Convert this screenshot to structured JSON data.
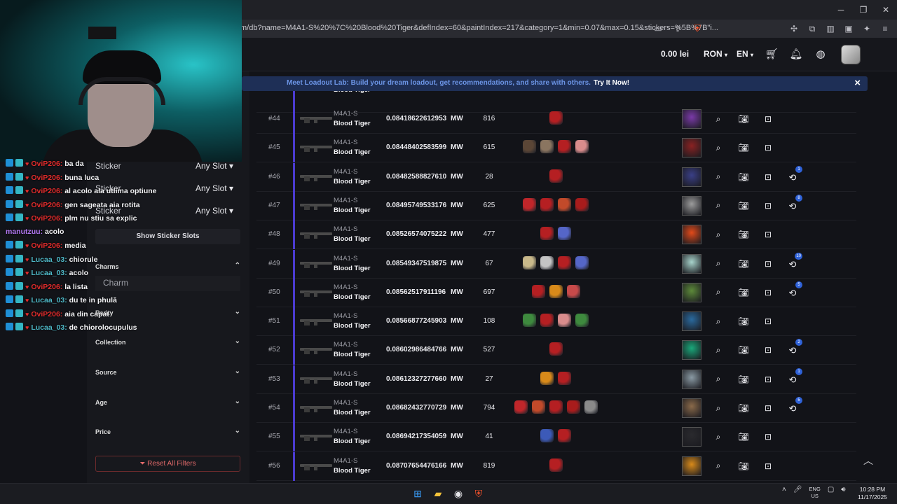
{
  "browser": {
    "url": "m/db?name=M4A1-S%20%7C%20Blood%20Tiger&defIndex=60&paintIndex=217&category=1&min=0.07&max=0.15&stickers=%5B%7B\"i..."
  },
  "header": {
    "balance": "0.00 lei",
    "currency": "RON",
    "language": "EN"
  },
  "banner": {
    "text": "Meet Loadout Lab: Build your dream loadout, get recommendations, and share with others.",
    "link": "Try It Now!",
    "close": "×"
  },
  "filters": {
    "sticker_rows": [
      {
        "label": "Sticker",
        "value": "Any Slot"
      },
      {
        "label": "Sticker",
        "value": "Any Slot"
      },
      {
        "label": "Sticker",
        "value": "Any Slot"
      }
    ],
    "show_sticker_slots": "Show Sticker Slots",
    "charms_head": "Charms",
    "charm_placeholder": "Charm",
    "rarity_head": "Rarity",
    "collection_head": "Collection",
    "source_head": "Source",
    "age_head": "Age",
    "price_head": "Price",
    "reset": "Reset All Filters"
  },
  "partial_row": {
    "skin": "Blood Tiger"
  },
  "rows": [
    {
      "idx": "#44",
      "weapon": "M4A1-S",
      "skin": "Blood Tiger",
      "float": "0.08418622612953",
      "wear": "MW",
      "seed": "816",
      "stickers": [
        "#b51f22"
      ],
      "owner": "#7a3aa8",
      "history": ""
    },
    {
      "idx": "#45",
      "weapon": "M4A1-S",
      "skin": "Blood Tiger",
      "float": "0.08448402583599",
      "wear": "MW",
      "seed": "615",
      "stickers": [
        "#5b4636",
        "#8a7560",
        "#b51f22",
        "#d98c8c"
      ],
      "owner": "#8a2222",
      "history": ""
    },
    {
      "idx": "#46",
      "weapon": "M4A1-S",
      "skin": "Blood Tiger",
      "float": "0.08482588827610",
      "wear": "MW",
      "seed": "28",
      "stickers": [
        "#b51f22"
      ],
      "owner": "#3a3f86",
      "history": "1"
    },
    {
      "idx": "#47",
      "weapon": "M4A1-S",
      "skin": "Blood Tiger",
      "float": "0.08495749533176",
      "wear": "MW",
      "seed": "625",
      "stickers": [
        "#c0262a",
        "#b51f22",
        "#c24a2a",
        "#a81c1c"
      ],
      "owner": "#9c9c9c",
      "history": "8"
    },
    {
      "idx": "#48",
      "weapon": "M4A1-S",
      "skin": "Blood Tiger",
      "float": "0.08526574075222",
      "wear": "MW",
      "seed": "477",
      "stickers": [
        "#b51f22",
        "#5566c8"
      ],
      "owner": "#e24a1a",
      "history": ""
    },
    {
      "idx": "#49",
      "weapon": "M4A1-S",
      "skin": "Blood Tiger",
      "float": "0.08549347519875",
      "wear": "MW",
      "seed": "67",
      "stickers": [
        "#c8b88a",
        "#c4c4c4",
        "#b51f22",
        "#5566c8"
      ],
      "owner": "#a8d4cc",
      "history": "10"
    },
    {
      "idx": "#50",
      "weapon": "M4A1-S",
      "skin": "Blood Tiger",
      "float": "0.08562517911196",
      "wear": "MW",
      "seed": "697",
      "stickers": [
        "#b51f22",
        "#d88a1a",
        "#c84a4a"
      ],
      "owner": "#5d8a3a",
      "history": "5"
    },
    {
      "idx": "#51",
      "weapon": "M4A1-S",
      "skin": "Blood Tiger",
      "float": "0.08566877245903",
      "wear": "MW",
      "seed": "108",
      "stickers": [
        "#3e8a3e",
        "#b51f22",
        "#d98c8c",
        "#3e8a3e"
      ],
      "owner": "#2a6a9e",
      "history": ""
    },
    {
      "idx": "#52",
      "weapon": "M4A1-S",
      "skin": "Blood Tiger",
      "float": "0.08602986484766",
      "wear": "MW",
      "seed": "527",
      "stickers": [
        "#b51f22"
      ],
      "owner": "#1aa87a",
      "history": "2"
    },
    {
      "idx": "#53",
      "weapon": "M4A1-S",
      "skin": "Blood Tiger",
      "float": "0.08612327277660",
      "wear": "MW",
      "seed": "27",
      "stickers": [
        "#d88a1a",
        "#b51f22"
      ],
      "owner": "#8a9aa4",
      "history": "1"
    },
    {
      "idx": "#54",
      "weapon": "M4A1-S",
      "skin": "Blood Tiger",
      "float": "0.08682432770729",
      "wear": "MW",
      "seed": "794",
      "stickers": [
        "#c0262a",
        "#c24a2a",
        "#b51f22",
        "#a81c1c",
        "#8a8a8a"
      ],
      "owner": "#8a6a4a",
      "history": "5"
    },
    {
      "idx": "#55",
      "weapon": "M4A1-S",
      "skin": "Blood Tiger",
      "float": "0.08694217354059",
      "wear": "MW",
      "seed": "41",
      "stickers": [
        "#3c5ab8",
        "#b51f22"
      ],
      "owner": "#2a2a2e",
      "history": ""
    },
    {
      "idx": "#56",
      "weapon": "M4A1-S",
      "skin": "Blood Tiger",
      "float": "0.08707654476166",
      "wear": "MW",
      "seed": "819",
      "stickers": [
        "#b51f22"
      ],
      "owner": "#d88a1a",
      "history": ""
    }
  ],
  "chat": [
    {
      "user": "OviP206:",
      "msg": "ba da",
      "color": "red"
    },
    {
      "user": "OviP206:",
      "msg": "buna luca",
      "color": "red"
    },
    {
      "user": "OviP206:",
      "msg": "al acolo ala utlima optiune",
      "color": "red"
    },
    {
      "user": "OviP206:",
      "msg": "gen sageata aia rotita",
      "color": "red"
    },
    {
      "user": "OviP206:",
      "msg": "plm nu stiu sa explic",
      "color": "red"
    },
    {
      "user": "manutzuu:",
      "msg": "acolo",
      "color": "purple"
    },
    {
      "user": "OviP206:",
      "msg": "media",
      "color": "red"
    },
    {
      "user": "Lucaa_03:",
      "msg": "chiorule",
      "color": "cyan"
    },
    {
      "user": "Lucaa_03:",
      "msg": "acolo",
      "color": "cyan"
    },
    {
      "user": "OviP206:",
      "msg": "la lista",
      "color": "red"
    },
    {
      "user": "Lucaa_03:",
      "msg": "du te in phulă",
      "color": "cyan"
    },
    {
      "user": "OviP206:",
      "msg": "aia din capat",
      "color": "red"
    },
    {
      "user": "Lucaa_03:",
      "msg": "de chiorolocupulus",
      "color": "cyan"
    }
  ],
  "taskbar": {
    "lang_top": "ENG",
    "lang_bottom": "US",
    "time": "10:28 PM",
    "date": "11/17/2025"
  }
}
